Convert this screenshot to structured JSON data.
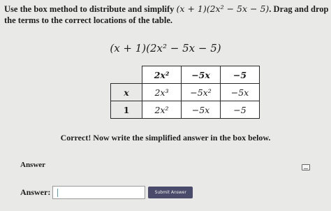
{
  "instructions": {
    "text_before": "Use the box method to distribute and simplify ",
    "expression": "(x + 1)(2x² − 5x − 5)",
    "text_after": ". Drag and drop the terms to the correct locations of the table."
  },
  "expression_display": "(x + 1)(2x² − 5x − 5)",
  "box_table": {
    "column_headers": [
      "2x²",
      "−5x",
      "−5"
    ],
    "rows": [
      {
        "header": "x",
        "cells": [
          "2x³",
          "−5x²",
          "−5x"
        ]
      },
      {
        "header": "1",
        "cells": [
          "2x²",
          "−5x",
          "−5"
        ]
      }
    ]
  },
  "feedback": "Correct! Now write the simplified answer in the box below.",
  "answer_section": {
    "heading": "Answer",
    "label": "Answer:",
    "input_value": "",
    "submit_label": "Submit Answer",
    "keyboard_icon": "keyboard-icon"
  },
  "colors": {
    "background": "#e9e9e7",
    "submit_button": "#4a4a6a",
    "table_border": "#2a2a2a"
  }
}
